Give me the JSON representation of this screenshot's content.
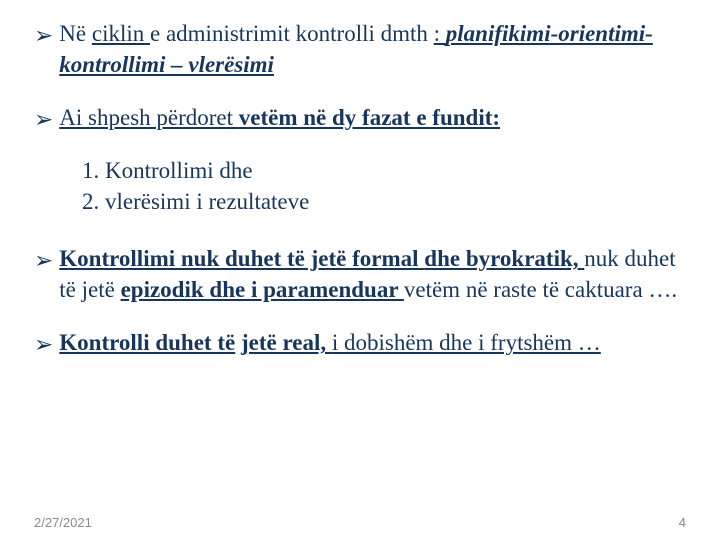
{
  "bullets": {
    "b1": {
      "p1": "Në",
      "p2": "ciklin ",
      "p3": "e administrimit kontrolli dmth ",
      "p4": ": ",
      "p5": "planifikimi-orientimi-kontrollimi – vlerësimi"
    },
    "b2": {
      "p1": "Ai shpesh përdoret ",
      "p2": "vetëm në dy fazat e fundit:"
    },
    "numlist": {
      "i1": "1. Kontrollimi dhe",
      "i2": "2. vlerësimi i rezultateve"
    },
    "b3": {
      "p1": "Kontrollimi nuk duhet të jetë formal ",
      "p2": "dhe byrokratik, ",
      "p3": "nuk duhet të jetë ",
      "p4": "epizodik dhe i paramenduar ",
      "p5": "vetëm në raste të caktuara …."
    },
    "b4": {
      "p1": "Kontrolli duhet të",
      "p2": "jetë real, ",
      "p3": "i dobishëm dhe i frytshëm …"
    }
  },
  "footer": {
    "date": "2/27/2021",
    "page": "4"
  }
}
